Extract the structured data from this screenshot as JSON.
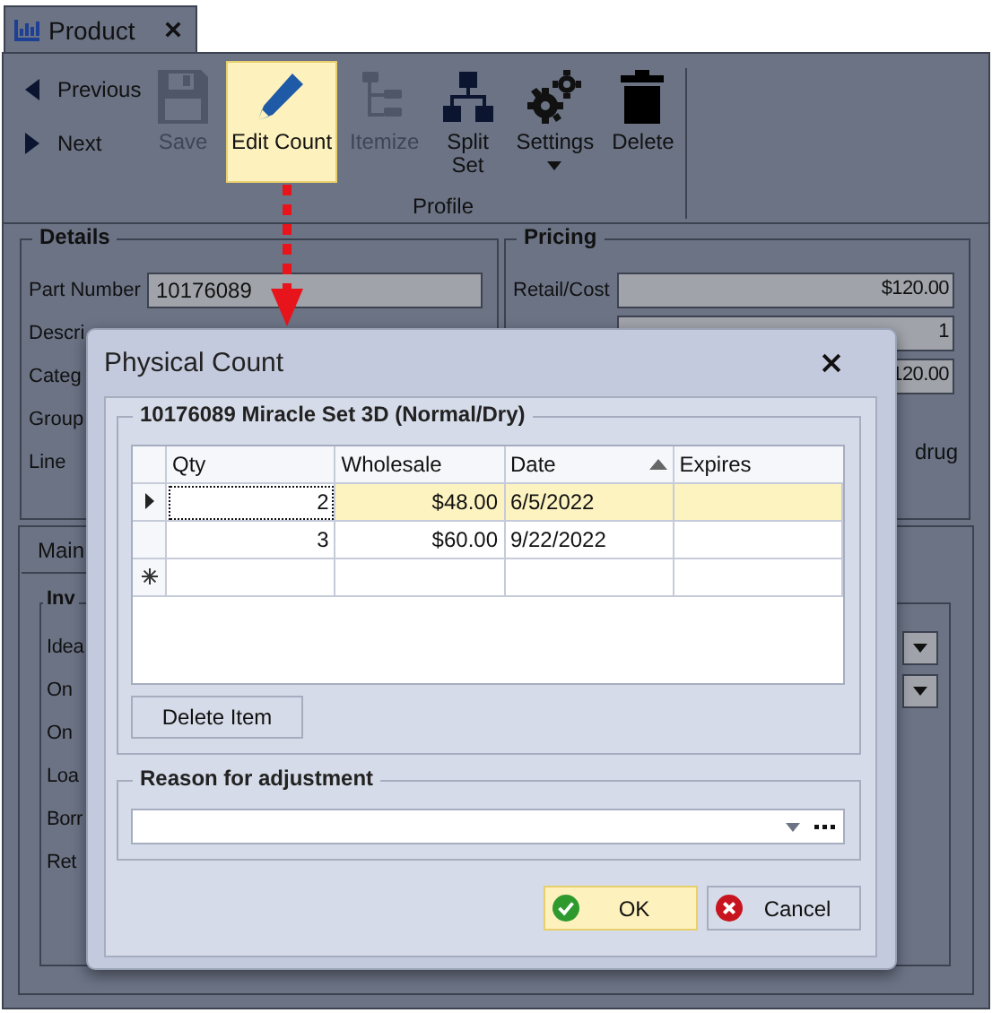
{
  "tab": {
    "title": "Product",
    "selected": true
  },
  "ribbon": {
    "nav": [
      {
        "label": "Previous",
        "kind": "prev"
      },
      {
        "label": "Next",
        "kind": "next"
      }
    ],
    "buttons": [
      {
        "label": "Save",
        "kind": "save",
        "disabled": true,
        "highlighted": false
      },
      {
        "label": "Edit Count",
        "kind": "edit",
        "disabled": false,
        "highlighted": true
      },
      {
        "label": "Itemize",
        "kind": "itemize",
        "disabled": true,
        "highlighted": false
      },
      {
        "label": "Split Set",
        "kind": "split",
        "disabled": false,
        "highlighted": false
      },
      {
        "label": "Settings",
        "kind": "settings",
        "disabled": false,
        "highlighted": false,
        "has_menu": true
      },
      {
        "label": "Delete",
        "kind": "delete",
        "disabled": false,
        "highlighted": false
      }
    ],
    "group_label": "Profile"
  },
  "details": {
    "title": "Details",
    "fields": [
      {
        "label": "Part Number",
        "value": "10176089"
      },
      {
        "label": "Descri"
      },
      {
        "label": "Categ"
      },
      {
        "label": "Group"
      },
      {
        "label": "Line"
      }
    ]
  },
  "pricing": {
    "title": "Pricing",
    "fields": [
      {
        "label": "Retail/Cost",
        "value": "$120.00"
      },
      {
        "value": "1"
      },
      {
        "value": "120.00"
      }
    ],
    "note": "drug"
  },
  "lower_tabs": [
    {
      "label": "Main",
      "selected": true
    }
  ],
  "inventory": {
    "title": "Inv",
    "rows": [
      {
        "label": "Idea",
        "kind": "combo"
      },
      {
        "label": "On",
        "kind": "combo"
      },
      {
        "label": "On",
        "kind": "text"
      },
      {
        "label": "Loa",
        "kind": "text"
      },
      {
        "label": "Borr",
        "kind": "text"
      },
      {
        "label": "Ret",
        "kind": "text"
      }
    ]
  },
  "dialog": {
    "title": "Physical Count",
    "group_title": "10176089 Miracle Set 3D (Normal/Dry)",
    "columns": [
      {
        "label": "Qty",
        "sorted": false
      },
      {
        "label": "Wholesale",
        "sorted": false
      },
      {
        "label": "Date",
        "sorted": true
      },
      {
        "label": "Expires",
        "sorted": false
      }
    ],
    "rows": [
      {
        "kind": "data",
        "selected": true,
        "cells": [
          "2",
          "$48.00",
          "6/5/2022",
          ""
        ]
      },
      {
        "kind": "data",
        "selected": false,
        "cells": [
          "3",
          "$60.00",
          "9/22/2022",
          ""
        ]
      },
      {
        "kind": "new",
        "selected": false,
        "cells": [
          "",
          "",
          "",
          ""
        ]
      }
    ],
    "delete_button": "Delete Item",
    "reason": {
      "title": "Reason for adjustment"
    },
    "buttons": [
      {
        "label": "OK",
        "kind": "ok",
        "highlighted": true
      },
      {
        "label": "Cancel",
        "kind": "cancel",
        "highlighted": false
      }
    ]
  }
}
